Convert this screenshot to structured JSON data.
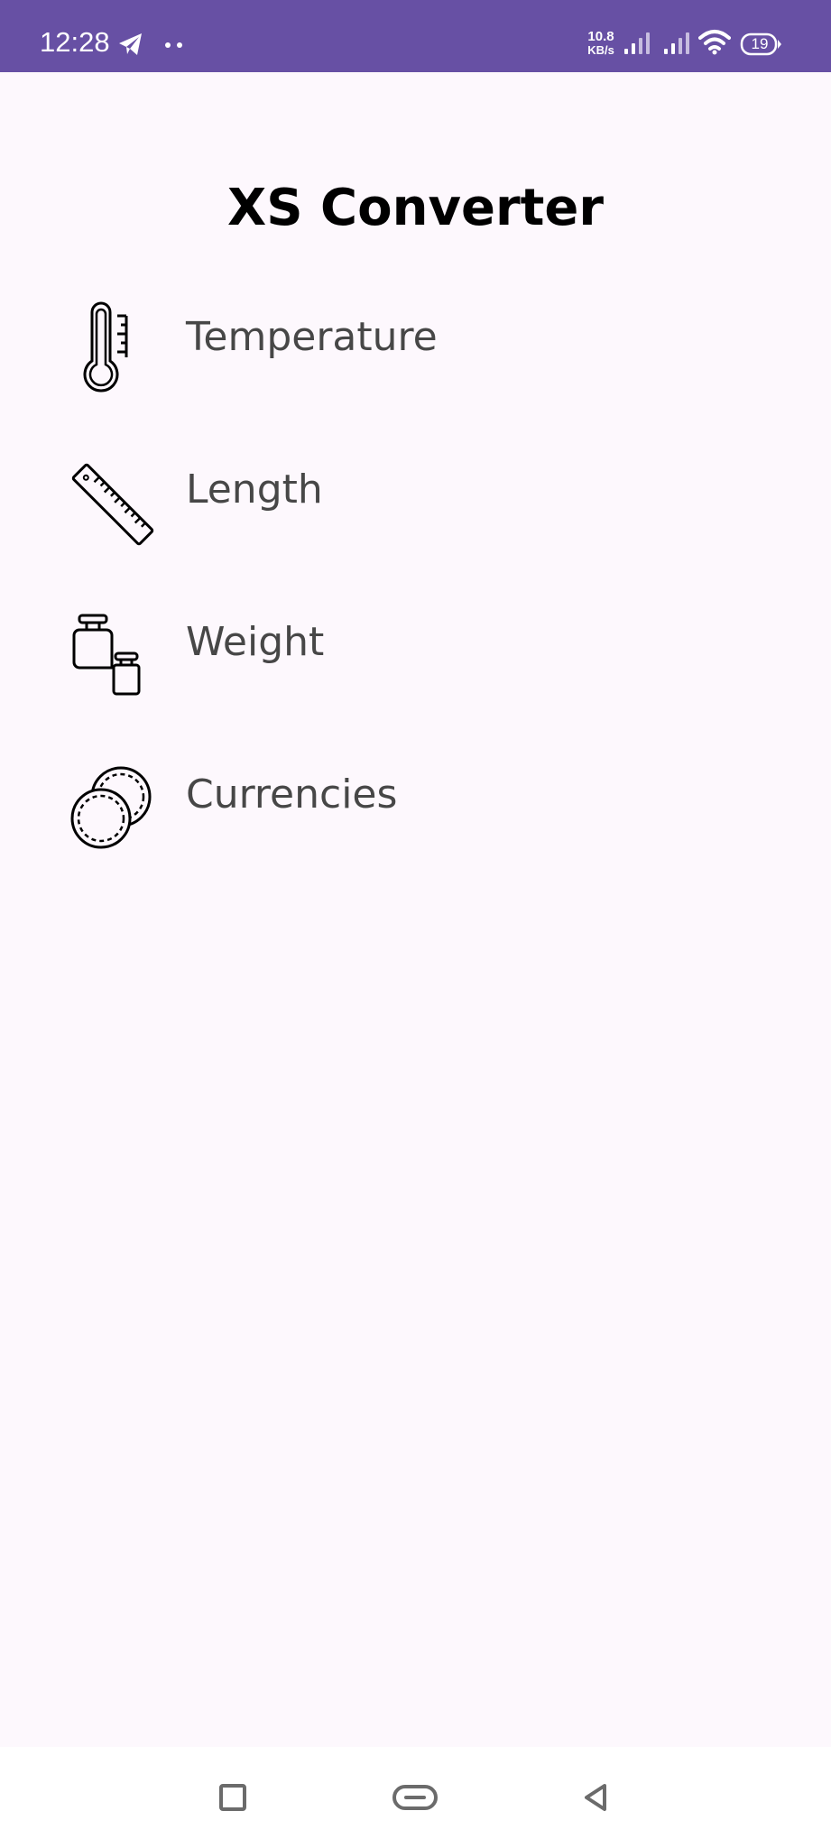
{
  "status_bar": {
    "time": "12:28",
    "network_speed_value": "10.8",
    "network_speed_unit": "KB/s",
    "battery_level": "19",
    "background_color": "#6750a4",
    "icons": [
      "telegram-icon",
      "dots-icon",
      "signal-icon",
      "signal-icon",
      "wifi-icon",
      "battery-icon"
    ]
  },
  "app": {
    "title": "XS Converter",
    "background_color": "#fdf8fd"
  },
  "menu": {
    "items": [
      {
        "label": "Temperature",
        "icon": "thermometer-icon"
      },
      {
        "label": "Length",
        "icon": "ruler-icon"
      },
      {
        "label": "Weight",
        "icon": "weights-icon"
      },
      {
        "label": "Currencies",
        "icon": "coins-icon"
      }
    ]
  },
  "nav_bar": {
    "buttons": [
      "recents-button",
      "home-button",
      "back-button"
    ]
  }
}
